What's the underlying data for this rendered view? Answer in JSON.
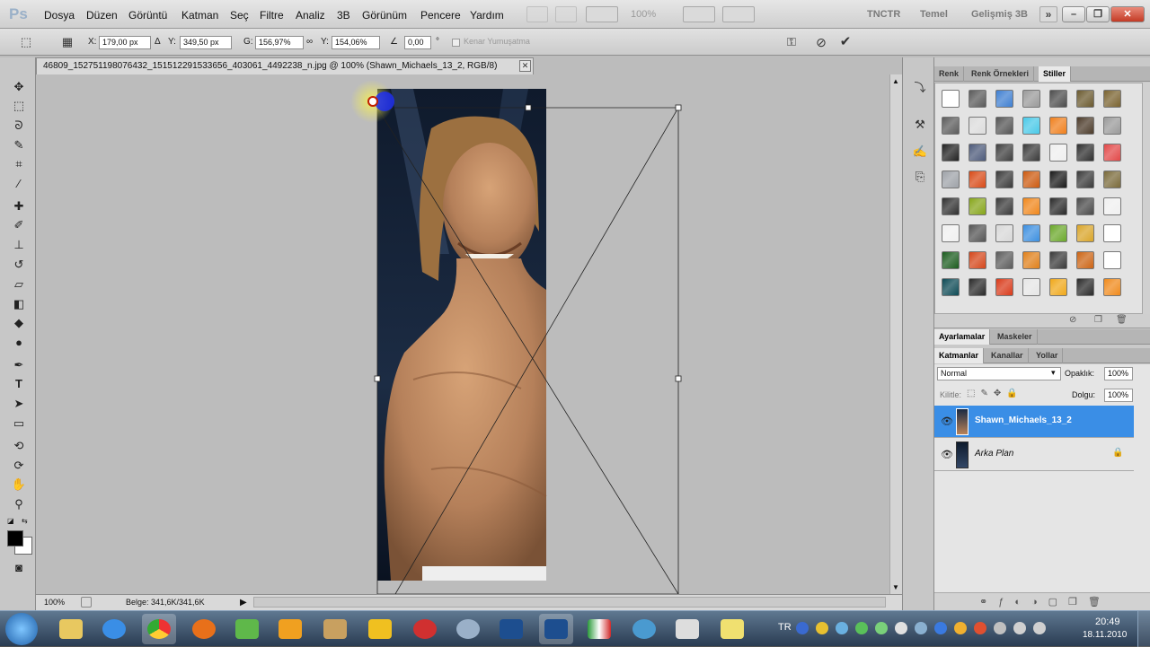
{
  "app": {
    "logo": "Ps"
  },
  "menu": [
    "Dosya",
    "Düzen",
    "Görüntü",
    "Katman",
    "Seç",
    "Filtre",
    "Analiz",
    "3B",
    "Görünüm",
    "Pencere",
    "Yardım"
  ],
  "menubar": {
    "zoom": "100%",
    "workspaces": [
      "TNCTR",
      "Temel",
      "Gelişmiş 3B"
    ],
    "more": "»"
  },
  "window_buttons": {
    "minimize": "–",
    "restore": "❐",
    "close": "✕"
  },
  "options": {
    "x_label": "X:",
    "x_value": "179,00 px",
    "y_label": "Y:",
    "y_value": "349,50 px",
    "w_label": "G:",
    "w_value": "156,97%",
    "h_label": "Y:",
    "h_value": "154,06%",
    "angle_value": "0,00",
    "degree": "°",
    "antialias_label": "Kenar Yumuşatma"
  },
  "document": {
    "tab_title": "46809_152751198076432_151512291533656_403061_4492238_n.jpg @ 100% (Shawn_Michaels_13_2, RGB/8)",
    "close": "✕"
  },
  "statusbar": {
    "zoom": "100%",
    "doc_info": "Belge: 341,6K/341,6K"
  },
  "panels": {
    "top_tabs": [
      "Renk",
      "Renk Örnekleri",
      "Stiller"
    ],
    "adjust_tabs": [
      "Ayarlamalar",
      "Maskeler"
    ],
    "layer_tabs": [
      "Katmanlar",
      "Kanallar",
      "Yollar"
    ],
    "blend_mode": "Normal",
    "opacity_label": "Opaklık:",
    "opacity_value": "100%",
    "lock_label": "Kilitle:",
    "fill_label": "Dolgu:",
    "fill_value": "100%",
    "layers": [
      {
        "name": "Shawn_Michaels_13_2",
        "selected": true
      },
      {
        "name": "Arka Plan",
        "selected": false
      }
    ]
  },
  "styles_colors": [
    "#ffffff",
    "#5a5a5a",
    "#3f7fd1",
    "#9a9a9a",
    "#4d4d4d",
    "#6b5a2f",
    "#7a6330",
    "#5c5c5c",
    "#dcdcdc",
    "#555555",
    "#49c9e8",
    "#f07f1c",
    "#4c3b2a",
    "#9a9a9a",
    "#222222",
    "#4d5a7a",
    "#3f3f3f",
    "#3a3a3a",
    "#efefef",
    "#2f2f2f",
    "#e24848",
    "#9ea2a8",
    "#d84a17",
    "#3a3a3a",
    "#cc5a10",
    "#1a1a1a",
    "#3a3a3a",
    "#7a6a3a",
    "#303030",
    "#86a51a",
    "#3a3a3a",
    "#f0871c",
    "#2a2a2a",
    "#4a4a4a",
    "#f0f0f0",
    "#f0f0f0",
    "#555555",
    "#d8d8d8",
    "#3c8fe0",
    "#6ba82b",
    "#d9a52a",
    "#ffffff",
    "#1b5c1e",
    "#d4461a",
    "#5c5c5c",
    "#e0801a",
    "#3a3a3a",
    "#cc6414",
    "#ffffff",
    "#0d4a55",
    "#2a2a2a",
    "#d93a1a",
    "#e6e6e6",
    "#f0a81a",
    "#2a2a2a",
    "#f08a1c"
  ],
  "taskbar": {
    "lang": "TR",
    "time": "20:49",
    "date": "18.11.2010"
  }
}
